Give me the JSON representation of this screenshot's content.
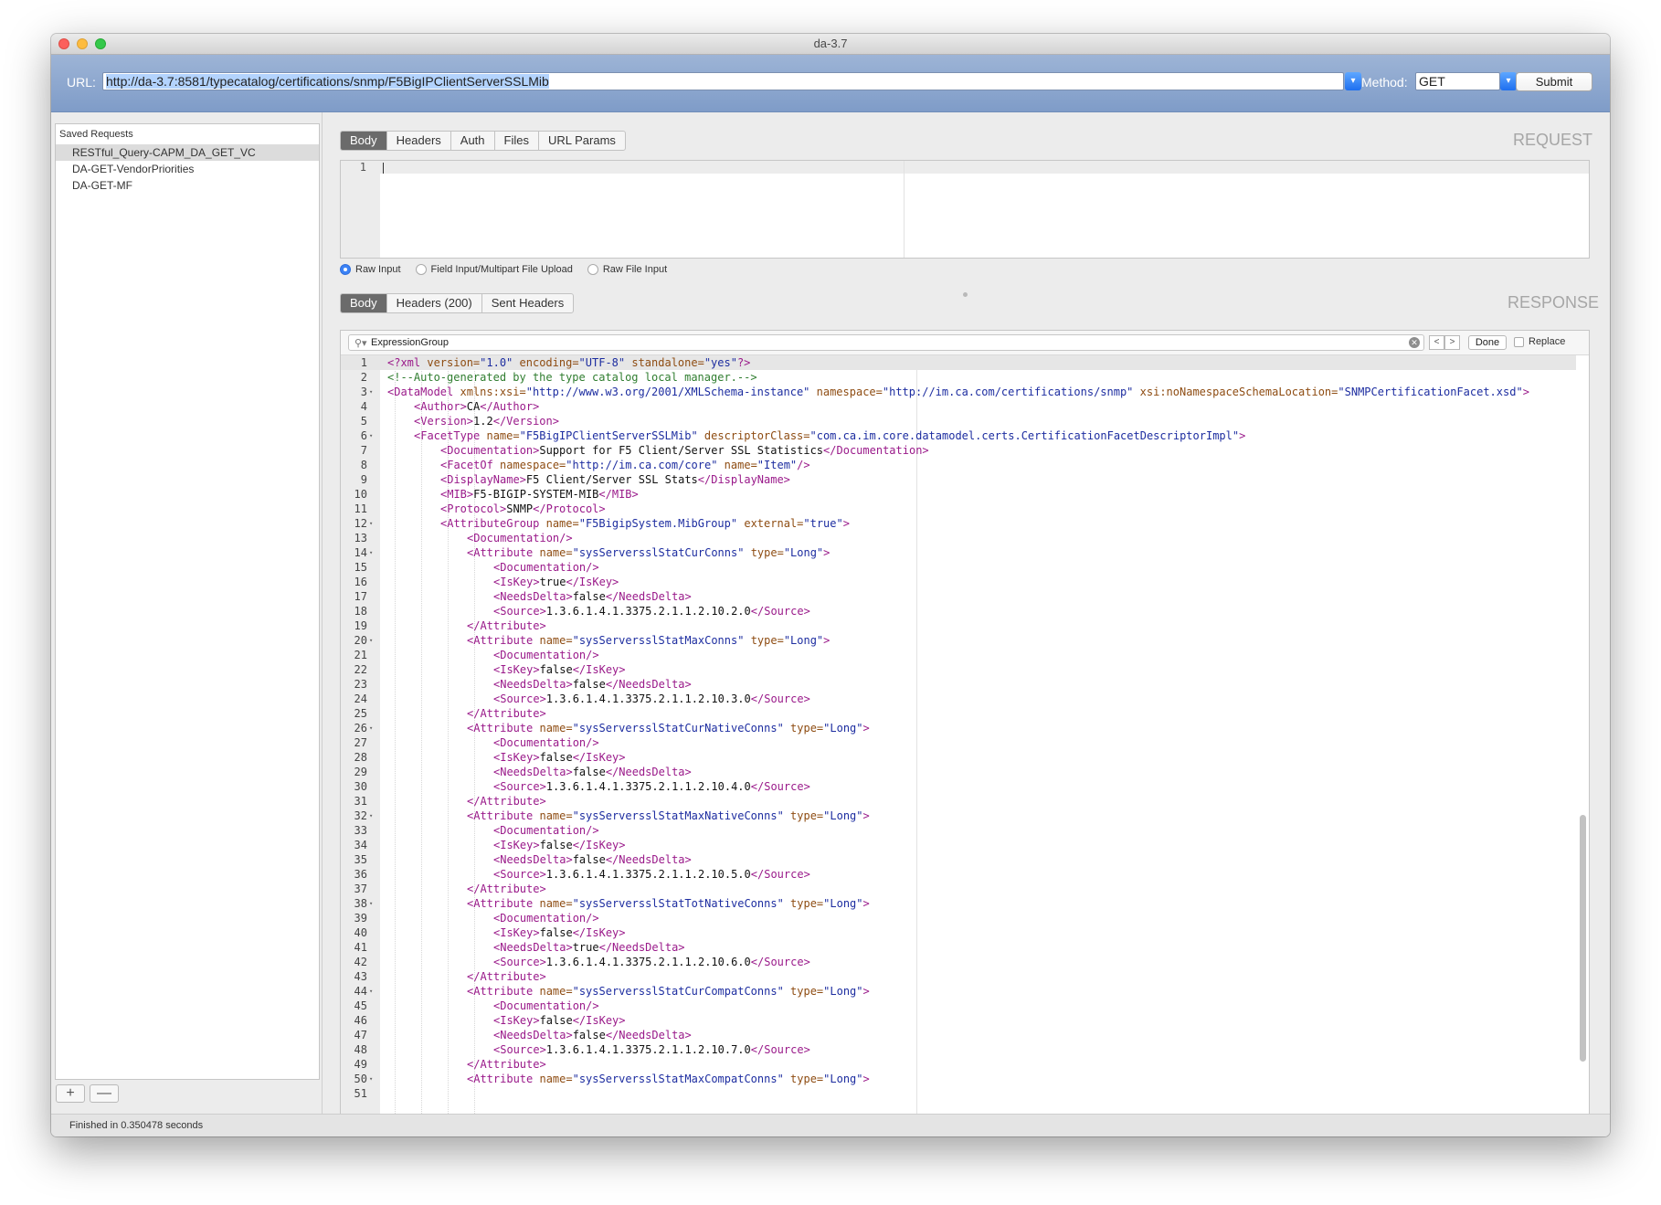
{
  "window": {
    "title": "da-3.7"
  },
  "urlbar": {
    "url_label": "URL:",
    "url_value": "http://da-3.7:8581/typecatalog/certifications/snmp/F5BigIPClientServerSSLMib",
    "method_label": "Method:",
    "method_value": "GET",
    "submit_label": "Submit"
  },
  "sidebar": {
    "header": "Saved Requests",
    "items": [
      {
        "label": "RESTful_Query-CAPM_DA_GET_VC",
        "selected": true
      },
      {
        "label": "DA-GET-VendorPriorities",
        "selected": false
      },
      {
        "label": "DA-GET-MF",
        "selected": false
      }
    ],
    "add_label": "+",
    "remove_label": "—"
  },
  "request": {
    "section_label": "REQUEST",
    "tabs": [
      {
        "label": "Body",
        "active": true
      },
      {
        "label": "Headers",
        "active": false
      },
      {
        "label": "Auth",
        "active": false
      },
      {
        "label": "Files",
        "active": false
      },
      {
        "label": "URL Params",
        "active": false
      }
    ],
    "editor_line_number": "1",
    "input_modes": [
      {
        "label": "Raw Input",
        "selected": true
      },
      {
        "label": "Field Input/Multipart File Upload",
        "selected": false
      },
      {
        "label": "Raw File Input",
        "selected": false
      }
    ]
  },
  "response": {
    "section_label": "RESPONSE",
    "tabs": [
      {
        "label": "Body",
        "active": true
      },
      {
        "label": "Headers (200)",
        "active": false
      },
      {
        "label": "Sent Headers",
        "active": false
      }
    ],
    "find": {
      "query": "ExpressionGroup",
      "prev_label": "<",
      "next_label": ">",
      "done_label": "Done",
      "replace_label": "Replace",
      "replace_checked": false
    },
    "code_lines": [
      {
        "n": "1",
        "fold": false,
        "indent": 0,
        "segs": [
          [
            "t",
            "<?xml "
          ],
          [
            "a",
            "version="
          ],
          [
            "v",
            "\"1.0\" "
          ],
          [
            "a",
            "encoding="
          ],
          [
            "v",
            "\"UTF-8\" "
          ],
          [
            "a",
            "standalone="
          ],
          [
            "v",
            "\"yes\""
          ],
          [
            "t",
            "?>"
          ]
        ]
      },
      {
        "n": "2",
        "fold": false,
        "indent": 0,
        "segs": [
          [
            "c",
            "<!--Auto-generated by the type catalog local manager.-->"
          ]
        ]
      },
      {
        "n": "3",
        "fold": true,
        "indent": 0,
        "segs": [
          [
            "t",
            "<DataModel "
          ],
          [
            "a",
            "xmlns:xsi="
          ],
          [
            "v",
            "\"http://www.w3.org/2001/XMLSchema-instance\" "
          ],
          [
            "a",
            "namespace="
          ],
          [
            "v",
            "\"http://im.ca.com/certifications/snmp\" "
          ],
          [
            "a",
            "xsi:noNamespaceSchemaLocation="
          ],
          [
            "v",
            "\"SNMPCertificationFacet.xsd\""
          ],
          [
            "t",
            ">"
          ]
        ]
      },
      {
        "n": "4",
        "fold": false,
        "indent": 1,
        "segs": [
          [
            "t",
            "<Author>"
          ],
          [
            "x",
            "CA"
          ],
          [
            "t",
            "</Author>"
          ]
        ]
      },
      {
        "n": "5",
        "fold": false,
        "indent": 1,
        "segs": [
          [
            "t",
            "<Version>"
          ],
          [
            "x",
            "1.2"
          ],
          [
            "t",
            "</Version>"
          ]
        ]
      },
      {
        "n": "6",
        "fold": true,
        "indent": 1,
        "segs": [
          [
            "t",
            "<FacetType "
          ],
          [
            "a",
            "name="
          ],
          [
            "v",
            "\"F5BigIPClientServerSSLMib\" "
          ],
          [
            "a",
            "descriptorClass="
          ],
          [
            "v",
            "\"com.ca.im.core.datamodel.certs.CertificationFacetDescriptorImpl\""
          ],
          [
            "t",
            ">"
          ]
        ]
      },
      {
        "n": "7",
        "fold": false,
        "indent": 2,
        "segs": [
          [
            "t",
            "<Documentation>"
          ],
          [
            "x",
            "Support for F5 Client/Server SSL Statistics"
          ],
          [
            "t",
            "</Documentation>"
          ]
        ]
      },
      {
        "n": "8",
        "fold": false,
        "indent": 2,
        "segs": [
          [
            "t",
            "<FacetOf "
          ],
          [
            "a",
            "namespace="
          ],
          [
            "v",
            "\"http://im.ca.com/core\" "
          ],
          [
            "a",
            "name="
          ],
          [
            "v",
            "\"Item\""
          ],
          [
            "t",
            "/>"
          ]
        ]
      },
      {
        "n": "9",
        "fold": false,
        "indent": 2,
        "segs": [
          [
            "t",
            "<DisplayName>"
          ],
          [
            "x",
            "F5 Client/Server SSL Stats"
          ],
          [
            "t",
            "</DisplayName>"
          ]
        ]
      },
      {
        "n": "10",
        "fold": false,
        "indent": 2,
        "segs": [
          [
            "t",
            "<MIB>"
          ],
          [
            "x",
            "F5-BIGIP-SYSTEM-MIB"
          ],
          [
            "t",
            "</MIB>"
          ]
        ]
      },
      {
        "n": "11",
        "fold": false,
        "indent": 2,
        "segs": [
          [
            "t",
            "<Protocol>"
          ],
          [
            "x",
            "SNMP"
          ],
          [
            "t",
            "</Protocol>"
          ]
        ]
      },
      {
        "n": "12",
        "fold": true,
        "indent": 2,
        "segs": [
          [
            "t",
            "<AttributeGroup "
          ],
          [
            "a",
            "name="
          ],
          [
            "v",
            "\"F5BigipSystem.MibGroup\" "
          ],
          [
            "a",
            "external="
          ],
          [
            "v",
            "\"true\""
          ],
          [
            "t",
            ">"
          ]
        ]
      },
      {
        "n": "13",
        "fold": false,
        "indent": 3,
        "segs": [
          [
            "t",
            "<Documentation/>"
          ]
        ]
      },
      {
        "n": "14",
        "fold": true,
        "indent": 3,
        "segs": [
          [
            "t",
            "<Attribute "
          ],
          [
            "a",
            "name="
          ],
          [
            "v",
            "\"sysServersslStatCurConns\" "
          ],
          [
            "a",
            "type="
          ],
          [
            "v",
            "\"Long\""
          ],
          [
            "t",
            ">"
          ]
        ]
      },
      {
        "n": "15",
        "fold": false,
        "indent": 4,
        "segs": [
          [
            "t",
            "<Documentation/>"
          ]
        ]
      },
      {
        "n": "16",
        "fold": false,
        "indent": 4,
        "segs": [
          [
            "t",
            "<IsKey>"
          ],
          [
            "x",
            "true"
          ],
          [
            "t",
            "</IsKey>"
          ]
        ]
      },
      {
        "n": "17",
        "fold": false,
        "indent": 4,
        "segs": [
          [
            "t",
            "<NeedsDelta>"
          ],
          [
            "x",
            "false"
          ],
          [
            "t",
            "</NeedsDelta>"
          ]
        ]
      },
      {
        "n": "18",
        "fold": false,
        "indent": 4,
        "segs": [
          [
            "t",
            "<Source>"
          ],
          [
            "x",
            "1.3.6.1.4.1.3375.2.1.1.2.10.2.0"
          ],
          [
            "t",
            "</Source>"
          ]
        ]
      },
      {
        "n": "19",
        "fold": false,
        "indent": 3,
        "segs": [
          [
            "t",
            "</Attribute>"
          ]
        ]
      },
      {
        "n": "20",
        "fold": true,
        "indent": 3,
        "segs": [
          [
            "t",
            "<Attribute "
          ],
          [
            "a",
            "name="
          ],
          [
            "v",
            "\"sysServersslStatMaxConns\" "
          ],
          [
            "a",
            "type="
          ],
          [
            "v",
            "\"Long\""
          ],
          [
            "t",
            ">"
          ]
        ]
      },
      {
        "n": "21",
        "fold": false,
        "indent": 4,
        "segs": [
          [
            "t",
            "<Documentation/>"
          ]
        ]
      },
      {
        "n": "22",
        "fold": false,
        "indent": 4,
        "segs": [
          [
            "t",
            "<IsKey>"
          ],
          [
            "x",
            "false"
          ],
          [
            "t",
            "</IsKey>"
          ]
        ]
      },
      {
        "n": "23",
        "fold": false,
        "indent": 4,
        "segs": [
          [
            "t",
            "<NeedsDelta>"
          ],
          [
            "x",
            "false"
          ],
          [
            "t",
            "</NeedsDelta>"
          ]
        ]
      },
      {
        "n": "24",
        "fold": false,
        "indent": 4,
        "segs": [
          [
            "t",
            "<Source>"
          ],
          [
            "x",
            "1.3.6.1.4.1.3375.2.1.1.2.10.3.0"
          ],
          [
            "t",
            "</Source>"
          ]
        ]
      },
      {
        "n": "25",
        "fold": false,
        "indent": 3,
        "segs": [
          [
            "t",
            "</Attribute>"
          ]
        ]
      },
      {
        "n": "26",
        "fold": true,
        "indent": 3,
        "segs": [
          [
            "t",
            "<Attribute "
          ],
          [
            "a",
            "name="
          ],
          [
            "v",
            "\"sysServersslStatCurNativeConns\" "
          ],
          [
            "a",
            "type="
          ],
          [
            "v",
            "\"Long\""
          ],
          [
            "t",
            ">"
          ]
        ]
      },
      {
        "n": "27",
        "fold": false,
        "indent": 4,
        "segs": [
          [
            "t",
            "<Documentation/>"
          ]
        ]
      },
      {
        "n": "28",
        "fold": false,
        "indent": 4,
        "segs": [
          [
            "t",
            "<IsKey>"
          ],
          [
            "x",
            "false"
          ],
          [
            "t",
            "</IsKey>"
          ]
        ]
      },
      {
        "n": "29",
        "fold": false,
        "indent": 4,
        "segs": [
          [
            "t",
            "<NeedsDelta>"
          ],
          [
            "x",
            "false"
          ],
          [
            "t",
            "</NeedsDelta>"
          ]
        ]
      },
      {
        "n": "30",
        "fold": false,
        "indent": 4,
        "segs": [
          [
            "t",
            "<Source>"
          ],
          [
            "x",
            "1.3.6.1.4.1.3375.2.1.1.2.10.4.0"
          ],
          [
            "t",
            "</Source>"
          ]
        ]
      },
      {
        "n": "31",
        "fold": false,
        "indent": 3,
        "segs": [
          [
            "t",
            "</Attribute>"
          ]
        ]
      },
      {
        "n": "32",
        "fold": true,
        "indent": 3,
        "segs": [
          [
            "t",
            "<Attribute "
          ],
          [
            "a",
            "name="
          ],
          [
            "v",
            "\"sysServersslStatMaxNativeConns\" "
          ],
          [
            "a",
            "type="
          ],
          [
            "v",
            "\"Long\""
          ],
          [
            "t",
            ">"
          ]
        ]
      },
      {
        "n": "33",
        "fold": false,
        "indent": 4,
        "segs": [
          [
            "t",
            "<Documentation/>"
          ]
        ]
      },
      {
        "n": "34",
        "fold": false,
        "indent": 4,
        "segs": [
          [
            "t",
            "<IsKey>"
          ],
          [
            "x",
            "false"
          ],
          [
            "t",
            "</IsKey>"
          ]
        ]
      },
      {
        "n": "35",
        "fold": false,
        "indent": 4,
        "segs": [
          [
            "t",
            "<NeedsDelta>"
          ],
          [
            "x",
            "false"
          ],
          [
            "t",
            "</NeedsDelta>"
          ]
        ]
      },
      {
        "n": "36",
        "fold": false,
        "indent": 4,
        "segs": [
          [
            "t",
            "<Source>"
          ],
          [
            "x",
            "1.3.6.1.4.1.3375.2.1.1.2.10.5.0"
          ],
          [
            "t",
            "</Source>"
          ]
        ]
      },
      {
        "n": "37",
        "fold": false,
        "indent": 3,
        "segs": [
          [
            "t",
            "</Attribute>"
          ]
        ]
      },
      {
        "n": "38",
        "fold": true,
        "indent": 3,
        "segs": [
          [
            "t",
            "<Attribute "
          ],
          [
            "a",
            "name="
          ],
          [
            "v",
            "\"sysServersslStatTotNativeConns\" "
          ],
          [
            "a",
            "type="
          ],
          [
            "v",
            "\"Long\""
          ],
          [
            "t",
            ">"
          ]
        ]
      },
      {
        "n": "39",
        "fold": false,
        "indent": 4,
        "segs": [
          [
            "t",
            "<Documentation/>"
          ]
        ]
      },
      {
        "n": "40",
        "fold": false,
        "indent": 4,
        "segs": [
          [
            "t",
            "<IsKey>"
          ],
          [
            "x",
            "false"
          ],
          [
            "t",
            "</IsKey>"
          ]
        ]
      },
      {
        "n": "41",
        "fold": false,
        "indent": 4,
        "segs": [
          [
            "t",
            "<NeedsDelta>"
          ],
          [
            "x",
            "true"
          ],
          [
            "t",
            "</NeedsDelta>"
          ]
        ]
      },
      {
        "n": "42",
        "fold": false,
        "indent": 4,
        "segs": [
          [
            "t",
            "<Source>"
          ],
          [
            "x",
            "1.3.6.1.4.1.3375.2.1.1.2.10.6.0"
          ],
          [
            "t",
            "</Source>"
          ]
        ]
      },
      {
        "n": "43",
        "fold": false,
        "indent": 3,
        "segs": [
          [
            "t",
            "</Attribute>"
          ]
        ]
      },
      {
        "n": "44",
        "fold": true,
        "indent": 3,
        "segs": [
          [
            "t",
            "<Attribute "
          ],
          [
            "a",
            "name="
          ],
          [
            "v",
            "\"sysServersslStatCurCompatConns\" "
          ],
          [
            "a",
            "type="
          ],
          [
            "v",
            "\"Long\""
          ],
          [
            "t",
            ">"
          ]
        ]
      },
      {
        "n": "45",
        "fold": false,
        "indent": 4,
        "segs": [
          [
            "t",
            "<Documentation/>"
          ]
        ]
      },
      {
        "n": "46",
        "fold": false,
        "indent": 4,
        "segs": [
          [
            "t",
            "<IsKey>"
          ],
          [
            "x",
            "false"
          ],
          [
            "t",
            "</IsKey>"
          ]
        ]
      },
      {
        "n": "47",
        "fold": false,
        "indent": 4,
        "segs": [
          [
            "t",
            "<NeedsDelta>"
          ],
          [
            "x",
            "false"
          ],
          [
            "t",
            "</NeedsDelta>"
          ]
        ]
      },
      {
        "n": "48",
        "fold": false,
        "indent": 4,
        "segs": [
          [
            "t",
            "<Source>"
          ],
          [
            "x",
            "1.3.6.1.4.1.3375.2.1.1.2.10.7.0"
          ],
          [
            "t",
            "</Source>"
          ]
        ]
      },
      {
        "n": "49",
        "fold": false,
        "indent": 3,
        "segs": [
          [
            "t",
            "</Attribute>"
          ]
        ]
      },
      {
        "n": "50",
        "fold": true,
        "indent": 3,
        "segs": [
          [
            "t",
            "<Attribute "
          ],
          [
            "a",
            "name="
          ],
          [
            "v",
            "\"sysServersslStatMaxCompatConns\" "
          ],
          [
            "a",
            "type="
          ],
          [
            "v",
            "\"Long\""
          ],
          [
            "t",
            ">"
          ]
        ]
      },
      {
        "n": "51",
        "fold": false,
        "indent": 0,
        "segs": []
      }
    ]
  },
  "status": {
    "text": "Finished in 0.350478 seconds"
  },
  "colors": {
    "accent": "#3b82f6",
    "tag": "#9a1a8a",
    "attr": "#8e4c12",
    "value": "#1d2da0",
    "comment": "#2f7d2f"
  }
}
